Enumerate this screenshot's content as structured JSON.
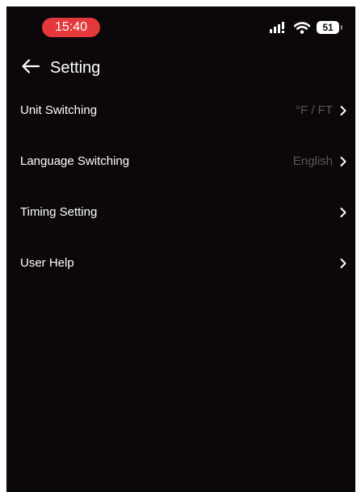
{
  "status_bar": {
    "time": "15:40",
    "battery": "51",
    "icons": [
      "signal-icon",
      "wifi-icon",
      "battery-icon"
    ]
  },
  "header": {
    "back_icon": "arrow-left-icon",
    "title": "Setting"
  },
  "settings": [
    {
      "label": "Unit Switching",
      "value": "°F / FT"
    },
    {
      "label": "Language Switching",
      "value": "English"
    },
    {
      "label": "Timing Setting",
      "value": ""
    },
    {
      "label": "User Help",
      "value": ""
    }
  ],
  "colors": {
    "background": "#0b070a",
    "time_pill": "#e5383b",
    "text": "#ffffff",
    "secondary_text": "#5a565a"
  }
}
